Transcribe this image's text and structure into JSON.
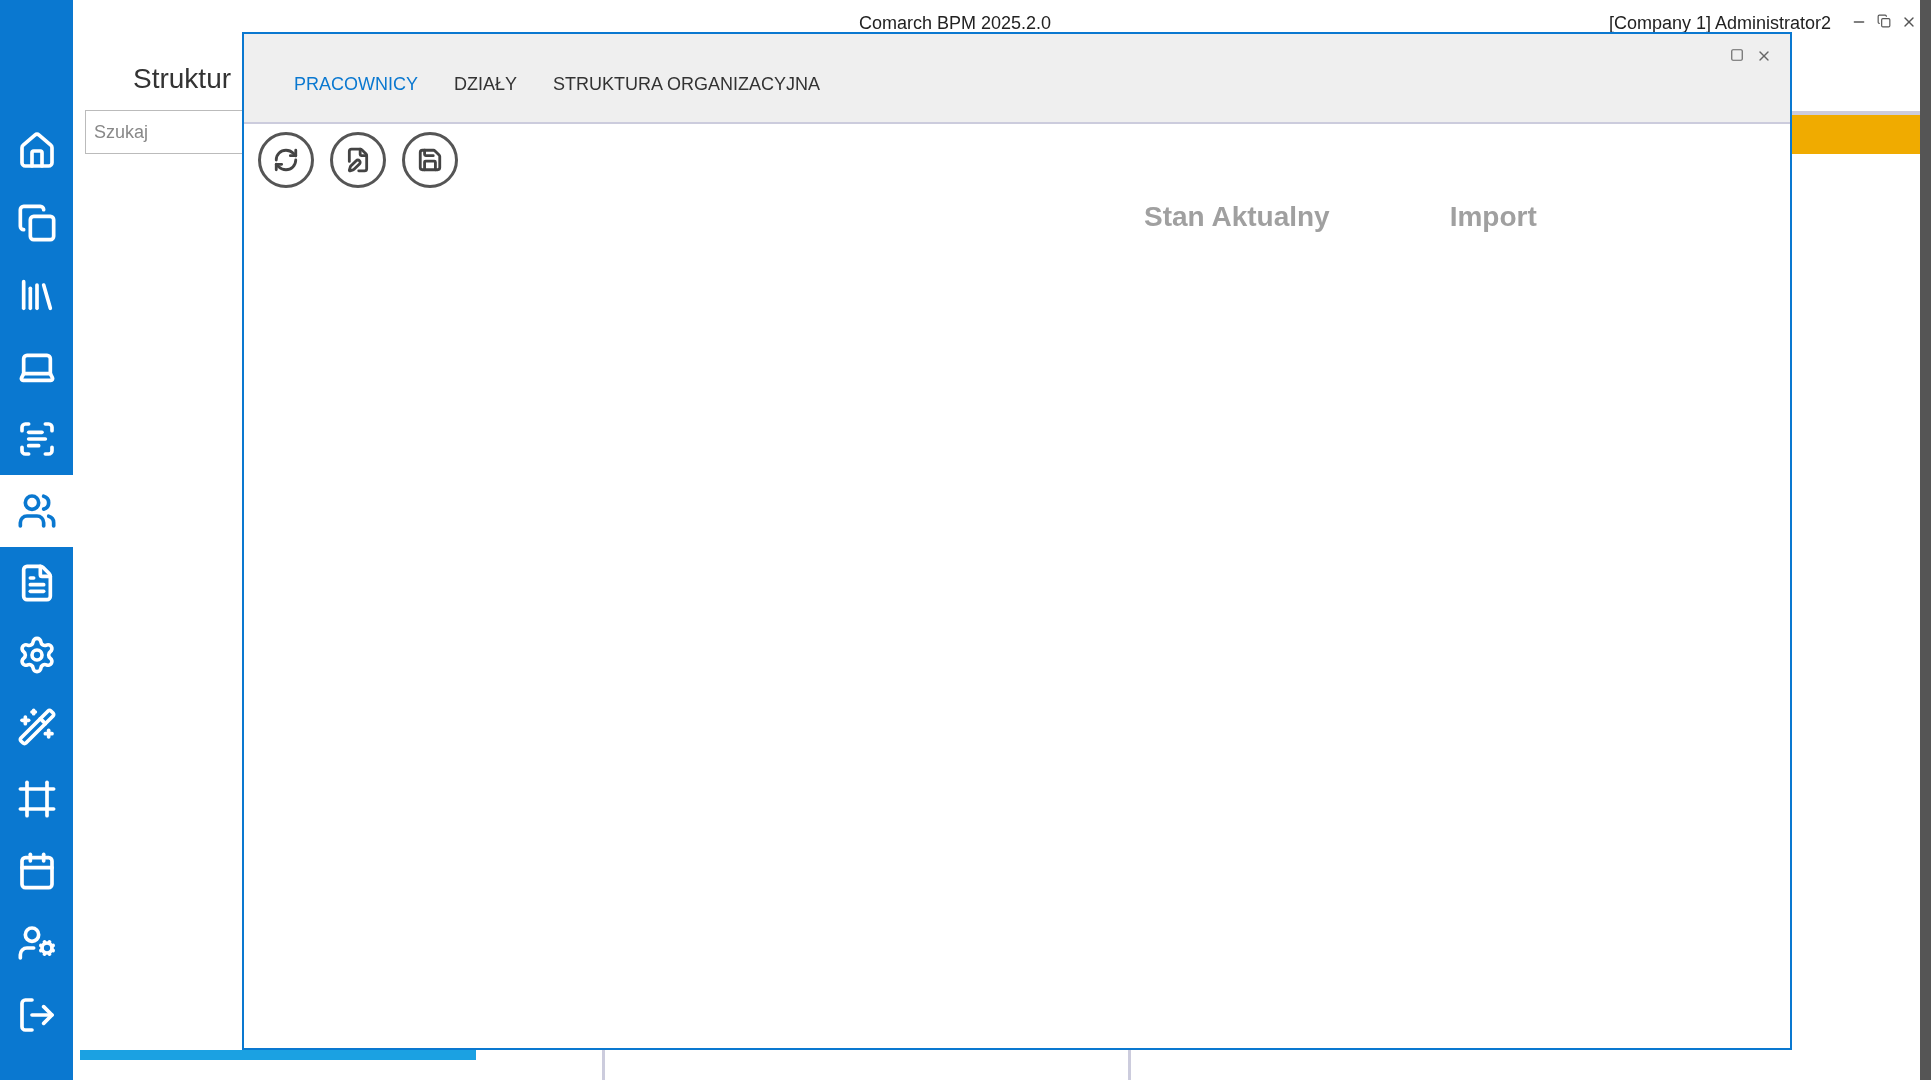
{
  "app": {
    "title": "Comarch BPM 2025.2.0",
    "user": "[Company 1]  Administrator2"
  },
  "sidebar": {
    "items": [
      {
        "selected": false
      },
      {
        "selected": false
      },
      {
        "selected": false
      },
      {
        "selected": false
      },
      {
        "selected": false
      },
      {
        "selected": true
      },
      {
        "selected": false
      },
      {
        "selected": false
      },
      {
        "selected": false
      },
      {
        "selected": false
      },
      {
        "selected": false
      },
      {
        "selected": false
      },
      {
        "selected": false
      }
    ]
  },
  "page": {
    "heading": "Struktur",
    "search": {
      "placeholder": "Szukaj"
    }
  },
  "dialog": {
    "tabs": [
      {
        "label": "PRACOWNICY",
        "selected": true
      },
      {
        "label": "DZIAŁY",
        "selected": false
      },
      {
        "label": "STRUKTURA ORGANIZACYJNA",
        "selected": false
      }
    ],
    "columns": [
      "Stan Aktualny",
      "Import"
    ]
  }
}
